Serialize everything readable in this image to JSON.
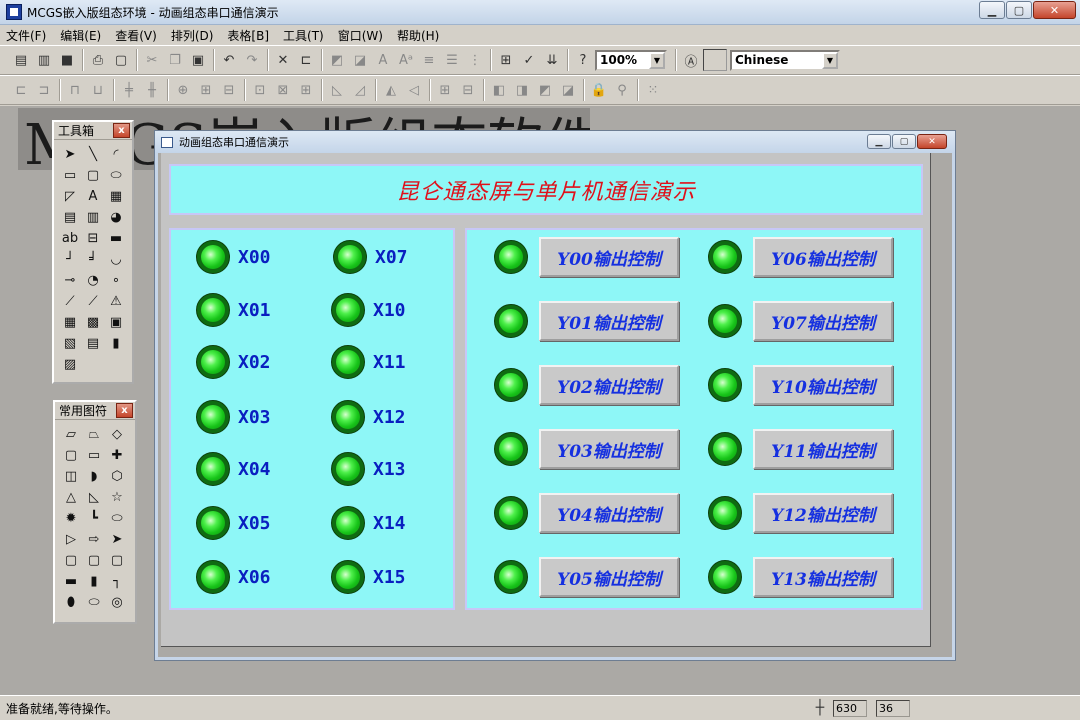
{
  "window": {
    "title": "MCGS嵌入版组态环境 - 动画组态串口通信演示",
    "minimize": "▁",
    "maximize": "▢",
    "close": "✕"
  },
  "menu": [
    "文件(F)",
    "编辑(E)",
    "查看(V)",
    "排列(D)",
    "表格[B]",
    "工具(T)",
    "窗口(W)",
    "帮助(H)"
  ],
  "toolbar": {
    "zoom": "100%",
    "language": "Chinese"
  },
  "background_banner": "MCGS嵌入版组态软件",
  "toolbox": {
    "title": "工具箱",
    "close": "x"
  },
  "shapes_palette": {
    "title": "常用图符",
    "close": "x"
  },
  "document": {
    "title": "动画组态串口通信演示",
    "banner": "昆仑通态屏与单片机通信演示",
    "inputs": [
      "X00",
      "X07",
      "X01",
      "X10",
      "X02",
      "X11",
      "X03",
      "X12",
      "X04",
      "X13",
      "X05",
      "X14",
      "X06",
      "X15"
    ],
    "outputs": [
      "Y00输出控制",
      "Y06输出控制",
      "Y01输出控制",
      "Y07输出控制",
      "Y02输出控制",
      "Y10输出控制",
      "Y03输出控制",
      "Y11输出控制",
      "Y04输出控制",
      "Y12输出控制",
      "Y05输出控制",
      "Y13输出控制"
    ]
  },
  "status": {
    "text": "准备就绪,等待操作。",
    "x": "630",
    "y": "36"
  }
}
